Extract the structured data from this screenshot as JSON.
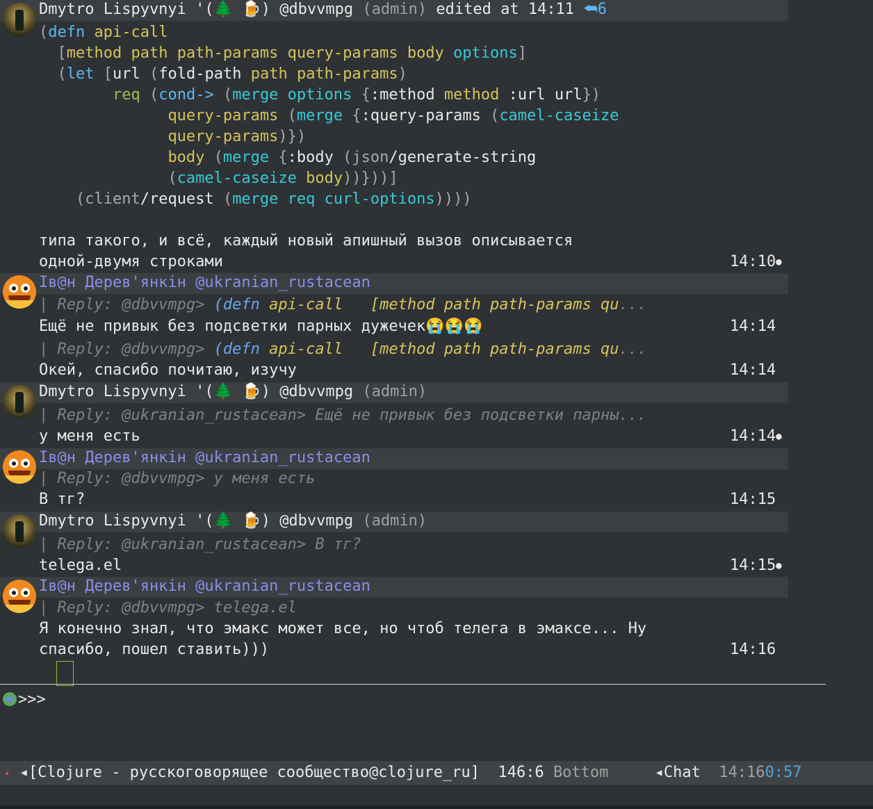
{
  "messages": {
    "m1_header": {
      "name": "Dmytro Lispyvnyi '(🌲 🍺)",
      "handle": "@dbvvmpg",
      "role": "(admin)",
      "edited": "edited at 14:11",
      "reply_count": "⮪6"
    },
    "code": [
      [
        "(",
        "defn",
        " ",
        "api-call"
      ],
      [
        "  [method path path-params query-params body options]"
      ],
      [
        "  (let [url (fold-path path path-params)"
      ],
      [
        "        req (cond-> (merge options {:method method :url url})"
      ],
      [
        "              query-params (merge {:query-params (camel-caseize"
      ],
      [
        "              query-params)})"
      ],
      [
        "              body (merge {:body (json/generate-string"
      ],
      [
        "              (camel-caseize body))}))]"
      ],
      [
        "    (client/request (merge req curl-options))))"
      ]
    ],
    "m1_text1": "типа такого, и всё, каждый новый апишный вызов описывается",
    "m1_text2": "одной-двумя строками",
    "m1_time": "14:10",
    "m2_name": "Ів@н Дерев'янкін @ukranian_rustacean",
    "m2_reply_prefix": "| Reply: @dbvvmpg> ",
    "m2_reply_defn": "(defn",
    "m2_reply_fn": "api-call",
    "m2_reply_vec": "   [method",
    "m2_reply_args": "path path-params qu",
    "m2_reply_ellipsis": "...",
    "m2_text": "Ещё не привык без подсветки парных дужечек😭😭😭",
    "m2_time": "14:14",
    "m3_text": "Окей, спасибо почитаю, изучу",
    "m3_time": "14:14",
    "m4_header": {
      "name": "Dmytro Lispyvnyi '(🌲 🍺)",
      "handle": "@dbvvmpg",
      "role": "(admin)"
    },
    "m4_reply": "| Reply: @ukranian_rustacean> Ещё не привык без подсветки парны...",
    "m4_text": "у меня есть",
    "m4_time": "14:14",
    "m5_name": "Ів@н Дерев'янкін @ukranian_rustacean",
    "m5_reply": "| Reply: @dbvvmpg> у меня есть",
    "m5_text": "В тг?",
    "m5_time": "14:15",
    "m6_header": {
      "name": "Dmytro Lispyvnyi '(🌲 🍺)",
      "handle": "@dbvvmpg",
      "role": "(admin)"
    },
    "m6_reply": "| Reply: @ukranian_rustacean> В тг?",
    "m6_text": "telega.el",
    "m6_time": "14:15",
    "m7_name": "Ів@н Дерев'янкін @ukranian_rustacean",
    "m7_reply": "| Reply: @dbvvmpg> telega.el",
    "m7_text1": "Я конечно знал, что эмакс может все, но чтоб телега в эмаксе... Ну",
    "m7_text2": "спасибо, пошел ставить)))",
    "m7_time": "14:16"
  },
  "prompt": ">>>",
  "modeline": {
    "indicator": "•",
    "arrow": "◂",
    "buffer": "[Clojure - русскоговорящее сообщество@clojure_ru]",
    "position": "146:6",
    "scroll": "Bottom",
    "mode_arrow": "◂",
    "mode": "Chat",
    "clock_a": "14:16",
    "clock_b": "0:57"
  },
  "colors": {
    "background": "#2e3235",
    "header_bg": "#3b3f42",
    "ivan_name": "#8a8ee8",
    "keyword": "#5db8f0",
    "function": "#38c9d6",
    "argument": "#d6c35a"
  }
}
